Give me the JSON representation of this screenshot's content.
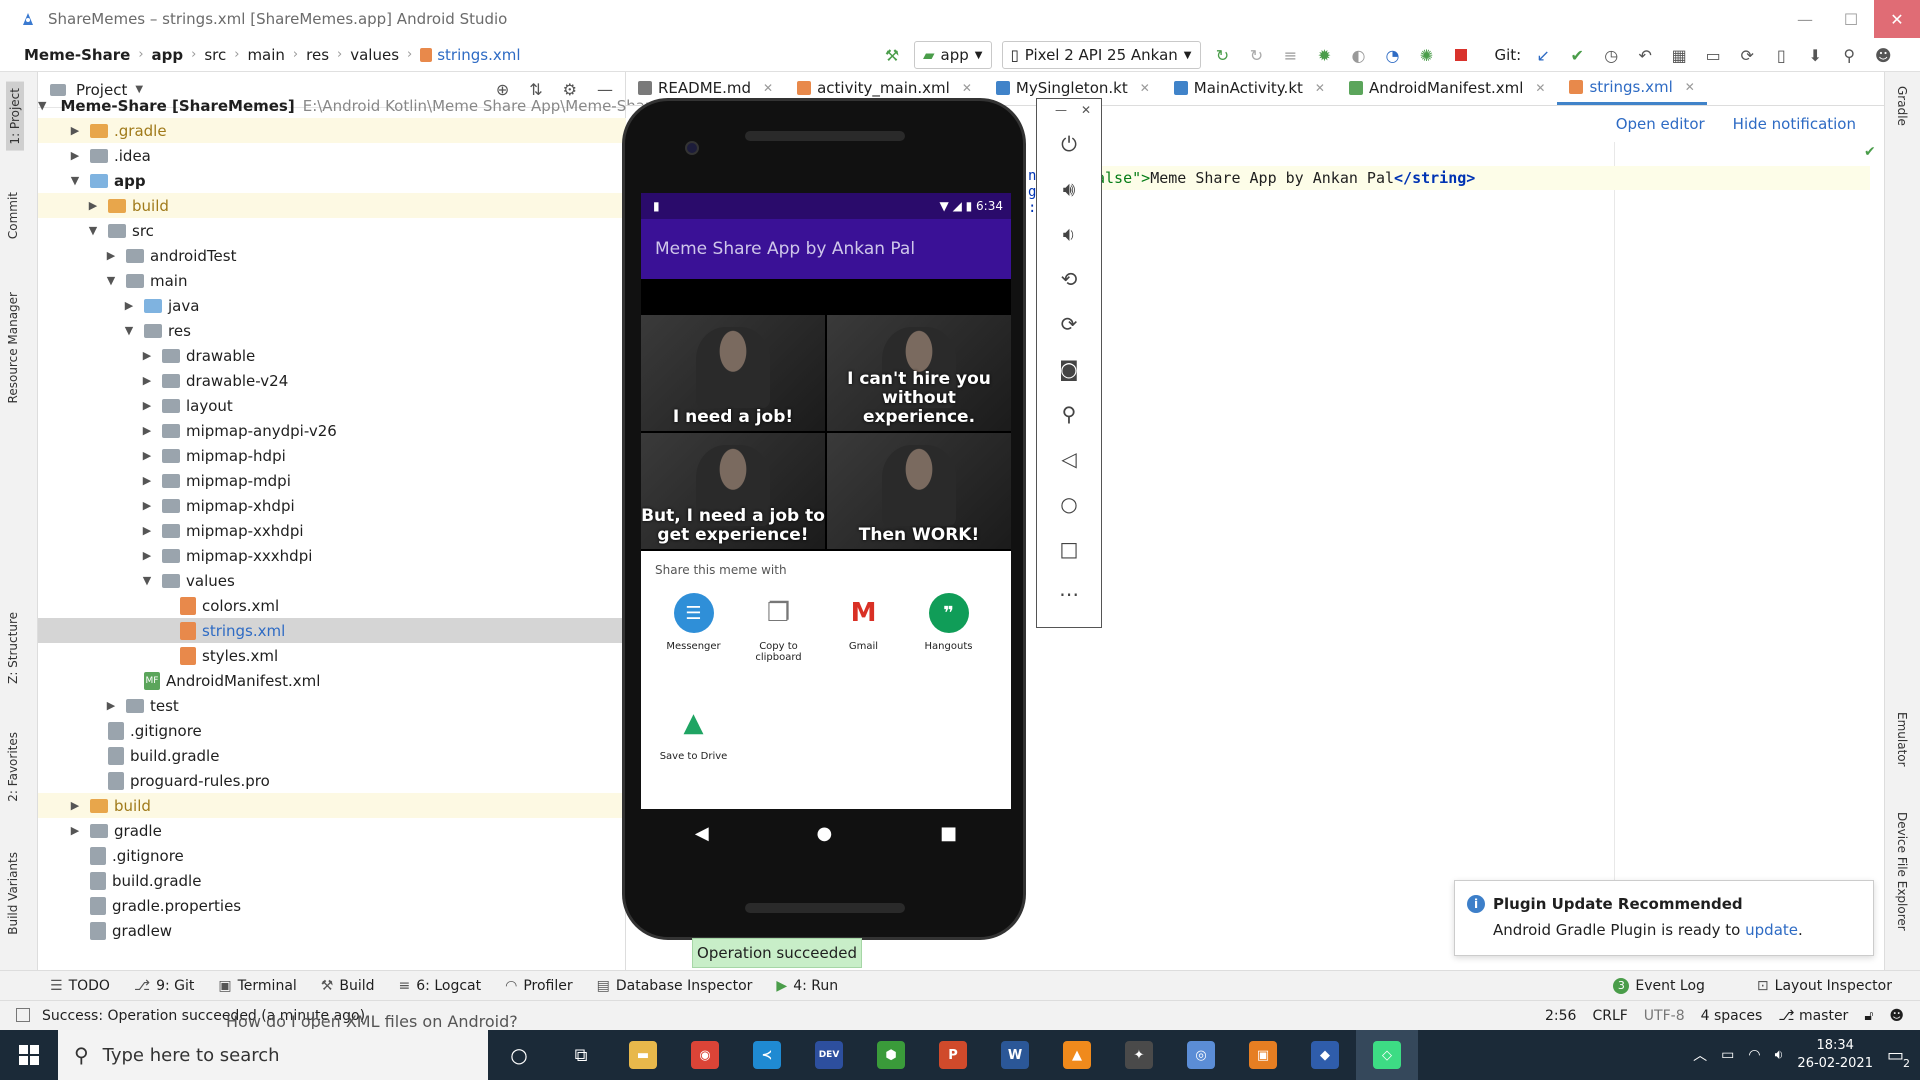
{
  "window": {
    "title": "ShareMemes – strings.xml [ShareMemes.app] Android Studio",
    "min": "—",
    "max": "☐",
    "close": "✕"
  },
  "breadcrumb": [
    "Meme-Share",
    "app",
    "src",
    "main",
    "res",
    "values",
    "strings.xml"
  ],
  "toolbar": {
    "config": "app",
    "device": "Pixel 2 API 25 Ankan",
    "git_label": "Git:"
  },
  "left_strip": [
    "1: Project",
    "Commit",
    "Resource Manager",
    "Z: Structure",
    "2: Favorites",
    "Build Variants"
  ],
  "right_strip": [
    "Gradle",
    "Emulator",
    "Device File Explorer"
  ],
  "project": {
    "header": "Project",
    "tree": [
      {
        "label": "Meme-Share [ShareMemes]",
        "sub": "E:\\Android Kotlin\\Meme Share App\\Meme-Share",
        "indent": 0,
        "arrow": "▼",
        "icon": "folder-blue",
        "bold": true
      },
      {
        "label": ".gradle",
        "indent": 1,
        "arrow": "▶",
        "icon": "folder-orange",
        "hl": true,
        "color": "olive"
      },
      {
        "label": ".idea",
        "indent": 1,
        "arrow": "▶",
        "icon": "folder-grey"
      },
      {
        "label": "app",
        "indent": 1,
        "arrow": "▼",
        "icon": "folder-blue",
        "bold": true
      },
      {
        "label": "build",
        "indent": 2,
        "arrow": "▶",
        "icon": "folder-orange",
        "hl": true,
        "color": "olive"
      },
      {
        "label": "src",
        "indent": 2,
        "arrow": "▼",
        "icon": "folder-grey"
      },
      {
        "label": "androidTest",
        "indent": 3,
        "arrow": "▶",
        "icon": "folder-grey"
      },
      {
        "label": "main",
        "indent": 3,
        "arrow": "▼",
        "icon": "folder-grey"
      },
      {
        "label": "java",
        "indent": 4,
        "arrow": "▶",
        "icon": "folder-blue"
      },
      {
        "label": "res",
        "indent": 4,
        "arrow": "▼",
        "icon": "folder-grey"
      },
      {
        "label": "drawable",
        "indent": 5,
        "arrow": "▶",
        "icon": "folder-grey"
      },
      {
        "label": "drawable-v24",
        "indent": 5,
        "arrow": "▶",
        "icon": "folder-grey"
      },
      {
        "label": "layout",
        "indent": 5,
        "arrow": "▶",
        "icon": "folder-grey"
      },
      {
        "label": "mipmap-anydpi-v26",
        "indent": 5,
        "arrow": "▶",
        "icon": "folder-grey"
      },
      {
        "label": "mipmap-hdpi",
        "indent": 5,
        "arrow": "▶",
        "icon": "folder-grey"
      },
      {
        "label": "mipmap-mdpi",
        "indent": 5,
        "arrow": "▶",
        "icon": "folder-grey"
      },
      {
        "label": "mipmap-xhdpi",
        "indent": 5,
        "arrow": "▶",
        "icon": "folder-grey"
      },
      {
        "label": "mipmap-xxhdpi",
        "indent": 5,
        "arrow": "▶",
        "icon": "folder-grey"
      },
      {
        "label": "mipmap-xxxhdpi",
        "indent": 5,
        "arrow": "▶",
        "icon": "folder-grey"
      },
      {
        "label": "values",
        "indent": 5,
        "arrow": "▼",
        "icon": "folder-grey"
      },
      {
        "label": "colors.xml",
        "indent": 6,
        "arrow": "",
        "icon": "xml"
      },
      {
        "label": "strings.xml",
        "indent": 6,
        "arrow": "",
        "icon": "xml",
        "sel": true,
        "color": "blue"
      },
      {
        "label": "styles.xml",
        "indent": 6,
        "arrow": "",
        "icon": "xml"
      },
      {
        "label": "AndroidManifest.xml",
        "indent": 4,
        "arrow": "",
        "icon": "mf"
      },
      {
        "label": "test",
        "indent": 3,
        "arrow": "▶",
        "icon": "folder-grey"
      },
      {
        "label": ".gitignore",
        "indent": 2,
        "arrow": "",
        "icon": "gen"
      },
      {
        "label": "build.gradle",
        "indent": 2,
        "arrow": "",
        "icon": "gen"
      },
      {
        "label": "proguard-rules.pro",
        "indent": 2,
        "arrow": "",
        "icon": "gen"
      },
      {
        "label": "build",
        "indent": 1,
        "arrow": "▶",
        "icon": "folder-orange",
        "hl": true,
        "color": "olive"
      },
      {
        "label": "gradle",
        "indent": 1,
        "arrow": "▶",
        "icon": "folder-grey"
      },
      {
        "label": ".gitignore",
        "indent": 1,
        "arrow": "",
        "icon": "gen"
      },
      {
        "label": "build.gradle",
        "indent": 1,
        "arrow": "",
        "icon": "gen"
      },
      {
        "label": "gradle.properties",
        "indent": 1,
        "arrow": "",
        "icon": "gen"
      },
      {
        "label": "gradlew",
        "indent": 1,
        "arrow": "",
        "icon": "gen"
      }
    ]
  },
  "editor": {
    "tabs": [
      {
        "label": "README.md",
        "color": "#7a7a7a"
      },
      {
        "label": "activity_main.xml",
        "color": "#e8894b"
      },
      {
        "label": "MySingleton.kt",
        "color": "#4083c9"
      },
      {
        "label": "MainActivity.kt",
        "color": "#4083c9"
      },
      {
        "label": "AndroidManifest.xml",
        "color": "#5ba55b"
      },
      {
        "label": "strings.xml",
        "color": "#e8894b",
        "active": true
      }
    ],
    "notif_open": "Open editor",
    "notif_hide": "Hide notification",
    "code_attr": "alse\">",
    "code_text": "Meme Share App by Ankan Pal",
    "code_close": "</string>",
    "code_fragments": [
      "n",
      "g",
      ":"
    ]
  },
  "phone": {
    "time": "6:34",
    "app_title": "Meme Share App by Ankan Pal",
    "meme_captions": [
      "I need a job!",
      "I can't hire you without experience.",
      "But, I need a job to get experience!",
      "Then WORK!"
    ],
    "share_title": "Share this meme with",
    "share_targets": [
      {
        "label": "Messenger",
        "color": "#2f8fd8",
        "glyph": "☰"
      },
      {
        "label": "Copy to clipboard",
        "color": "#ffffff",
        "glyph": "❐"
      },
      {
        "label": "Gmail",
        "color": "#ffffff",
        "glyph": "M"
      },
      {
        "label": "Hangouts",
        "color": "#109d58",
        "glyph": "❞"
      },
      {
        "label": "Save to Drive",
        "color": "#ffffff",
        "glyph": "▲"
      }
    ]
  },
  "emulator_controls": [
    "power-icon",
    "volume-up-icon",
    "volume-down-icon",
    "rotate-left-icon",
    "rotate-right-icon",
    "camera-icon",
    "zoom-icon",
    "back-icon",
    "home-icon",
    "overview-icon",
    "more-icon"
  ],
  "operation_popup": "Operation succeeded",
  "bottom_tools": [
    "TODO",
    "9: Git",
    "Terminal",
    "Build",
    "6: Logcat",
    "Profiler",
    "Database Inspector",
    "4: Run"
  ],
  "bottom_tools_right": [
    "Event Log",
    "Layout Inspector"
  ],
  "event_badge": "3",
  "status": {
    "message": "Success: Operation succeeded (a minute ago)",
    "overlay_text": "How do I open XML files on Android?",
    "position": "2:56",
    "line_sep": "CRLF",
    "encoding": "UTF-8",
    "indent": "4 spaces",
    "branch": "master"
  },
  "plugin": {
    "title": "Plugin Update Recommended",
    "body": "Android Gradle Plugin is ready to",
    "link": "update",
    "period": "."
  },
  "taskbar": {
    "search_placeholder": "Type here to search",
    "apps": [
      {
        "name": "file-explorer",
        "color": "#e8b84b",
        "glyph": "▬"
      },
      {
        "name": "chrome",
        "color": "#db4437",
        "glyph": "◉"
      },
      {
        "name": "vscode",
        "color": "#1f8ad2",
        "glyph": "≺"
      },
      {
        "name": "dev-cpp",
        "color": "#2d4f9e",
        "glyph": "DEV"
      },
      {
        "name": "app-green",
        "color": "#3a9b3a",
        "glyph": "⬢"
      },
      {
        "name": "powerpoint",
        "color": "#d04a2b",
        "glyph": "P"
      },
      {
        "name": "word",
        "color": "#2b5797",
        "glyph": "W"
      },
      {
        "name": "vlc",
        "color": "#f08a1c",
        "glyph": "▲"
      },
      {
        "name": "git-kraken",
        "color": "#4a4a4a",
        "glyph": "✦"
      },
      {
        "name": "app-circle",
        "color": "#5b8dd6",
        "glyph": "◎"
      },
      {
        "name": "app-orange",
        "color": "#e67e22",
        "glyph": "▣"
      },
      {
        "name": "app-white",
        "color": "#2f5dab",
        "glyph": "◆"
      },
      {
        "name": "android-studio",
        "color": "#3ddc84",
        "glyph": "◇"
      }
    ],
    "time": "18:34",
    "date": "26-02-2021",
    "notif_count": "2"
  }
}
